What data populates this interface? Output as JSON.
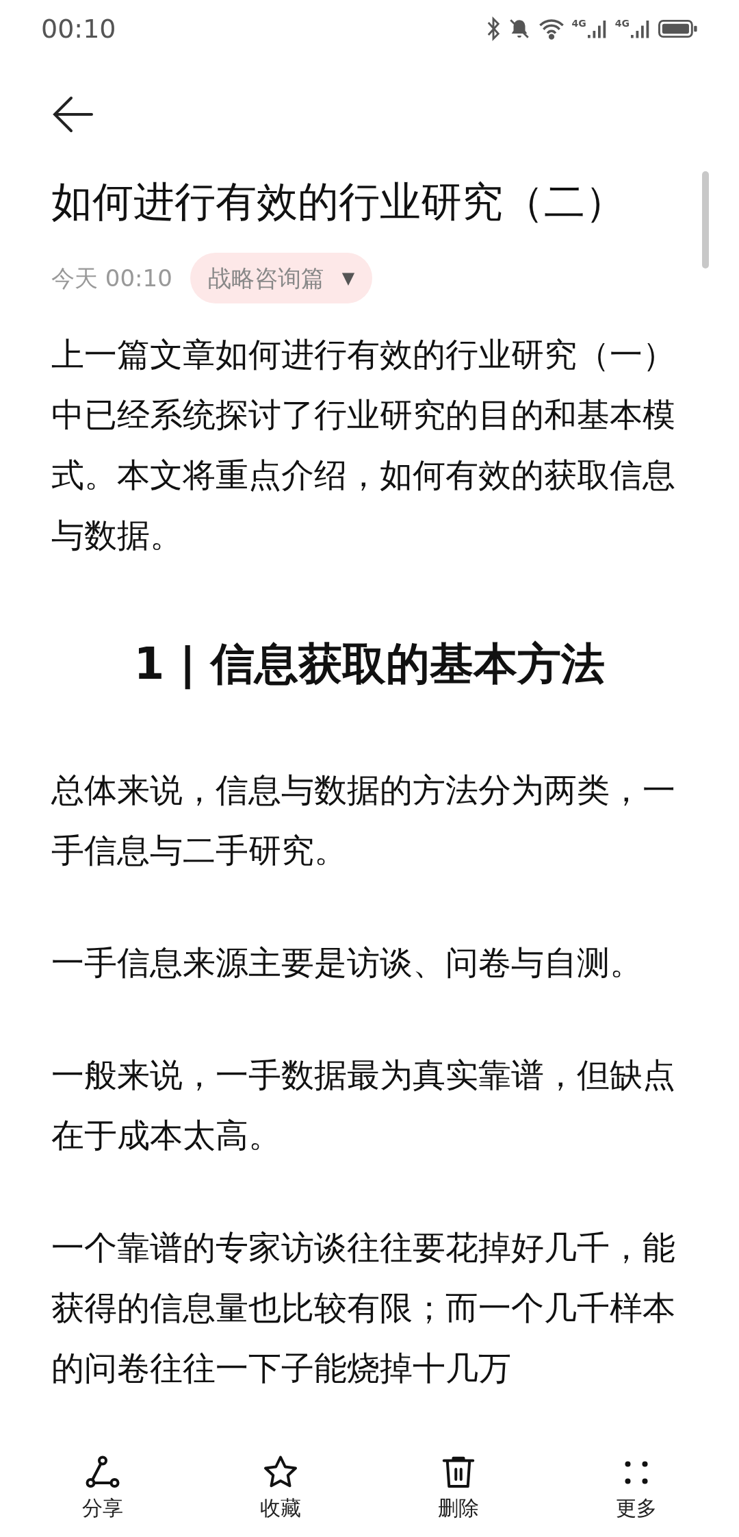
{
  "status_bar": {
    "time": "00:10",
    "signal_labels": [
      "4G",
      "4G"
    ]
  },
  "article": {
    "title": "如何进行有效的行业研究（二）",
    "date": "今天 00:10",
    "category": {
      "label": "战略咨询篇",
      "arrow": "▼"
    },
    "blocks": [
      {
        "kind": "paragraph",
        "text": "上一篇文章如何进行有效的行业研究（一）中已经系统探讨了行业研究的目的和基本模式。本文将重点介绍，如何有效的获取信息与数据。"
      },
      {
        "kind": "heading",
        "text": "1 | 信息获取的基本方法"
      },
      {
        "kind": "paragraph",
        "text": "总体来说，信息与数据的方法分为两类，一手信息与二手研究。"
      },
      {
        "kind": "paragraph",
        "text": "一手信息来源主要是访谈、问卷与自测。"
      },
      {
        "kind": "paragraph",
        "text": "一般来说，一手数据最为真实靠谱，但缺点在于成本太高。"
      },
      {
        "kind": "paragraph",
        "text": "一个靠谱的专家访谈往往要花掉好几千，能获得的信息量也比较有限；而一个几千样本的问卷往往一下子能烧掉十几万"
      }
    ]
  },
  "toolbar": [
    {
      "kind": "share",
      "label": "分享"
    },
    {
      "kind": "star",
      "label": "收藏"
    },
    {
      "kind": "trash",
      "label": "删除"
    },
    {
      "kind": "more",
      "label": "更多"
    }
  ]
}
